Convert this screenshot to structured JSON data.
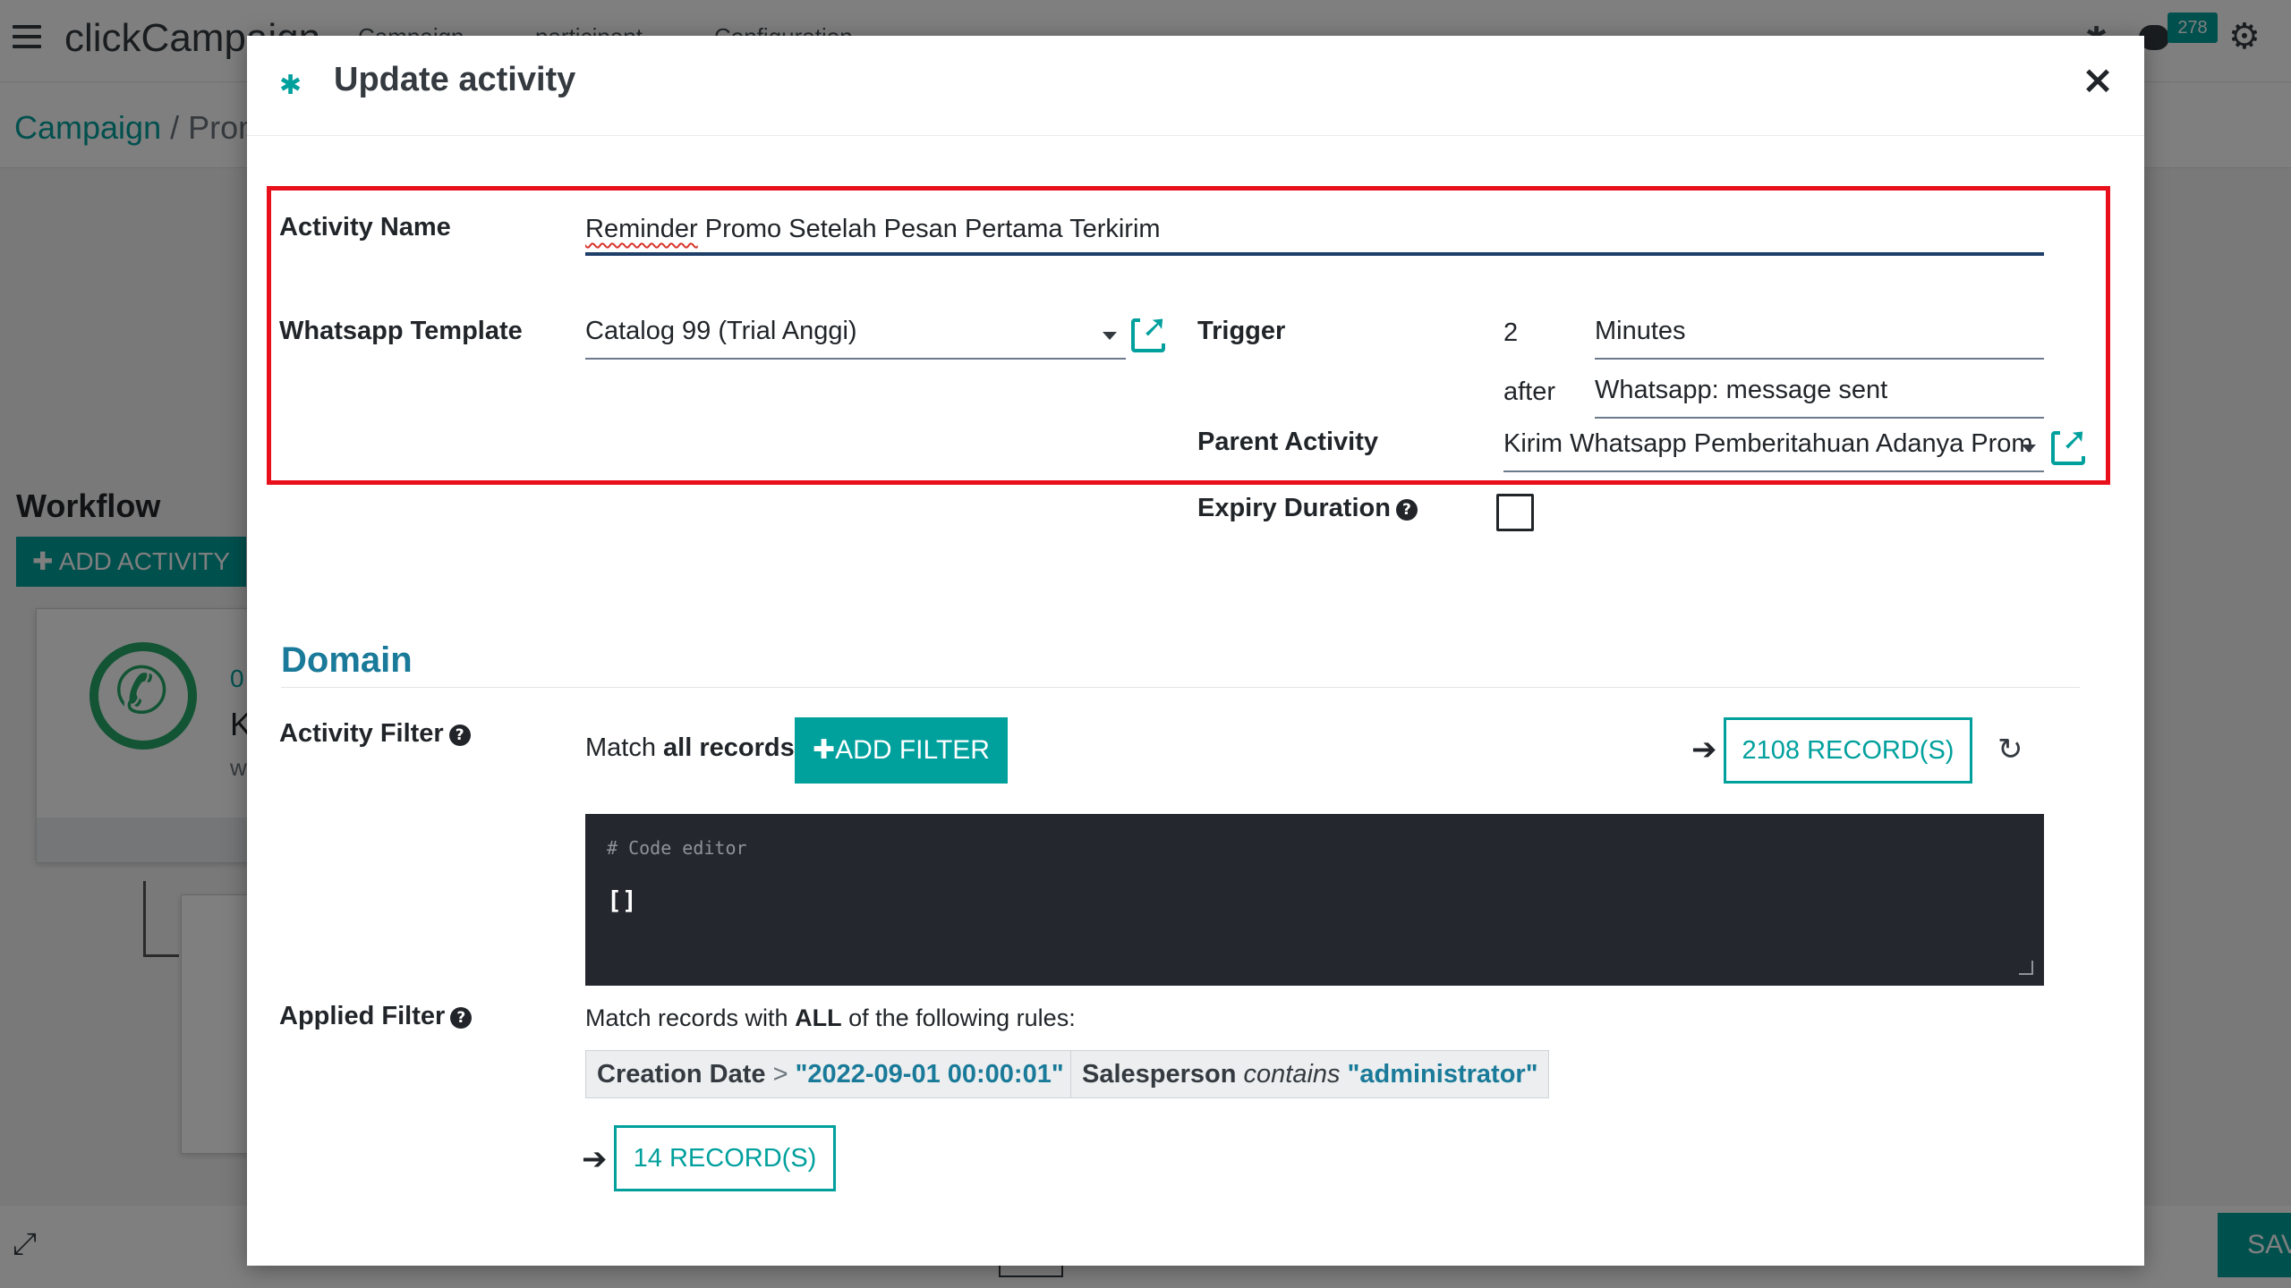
{
  "app": {
    "brand": "clickCampaign",
    "top_menu": [
      "Campaign",
      "participant",
      "Configuration"
    ],
    "notification_count": "278",
    "breadcrumb": {
      "root": "Campaign",
      "separator": " / ",
      "current": "Prom"
    },
    "workflow_title": "Workflow",
    "add_activity_label": "✚  ADD ACTIVITY",
    "card1_count": "0",
    "card1_initial": "K",
    "card1_sub": "w",
    "save_label": "SAV"
  },
  "modal": {
    "title": "Update activity",
    "close_glyph": "×",
    "activity_name_label": "Activity Name",
    "activity_name_misspelled": "Reminder",
    "activity_name_rest": " Promo Setelah Pesan Pertama Terkirim",
    "template_label": "Whatsapp Template",
    "template_value": "Catalog 99 (Trial Anggi)",
    "trigger_label": "Trigger",
    "trigger_number": "2",
    "trigger_unit": "Minutes",
    "trigger_after": "after",
    "trigger_event": "Whatsapp: message sent",
    "parent_label": "Parent Activity",
    "parent_value": "Kirim Whatsapp Pemberitahuan Adanya Prom",
    "expiry_label": "Expiry Duration",
    "expiry_checked": false,
    "domain_title": "Domain",
    "activity_filter_label": "Activity Filter",
    "match_prefix": "Match ",
    "match_bold": "all records",
    "add_filter_label": "✚ADD FILTER",
    "records_count_label": "2108 RECORD(S)",
    "code_comment": "# Code editor",
    "code_value": "[]",
    "applied_filter_label": "Applied Filter",
    "rules_prefix": "Match records with ",
    "rules_bold": "ALL",
    "rules_suffix": " of the following rules:",
    "rule1": {
      "field": "Creation Date",
      "operator": ">",
      "value": "\"2022-09-01 00:00:01\""
    },
    "rule2": {
      "field": "Salesperson",
      "operator": "contains",
      "value": "\"administrator\""
    },
    "applied_records_label": "14 RECORD(S)"
  },
  "colors": {
    "accent": "#00a09d",
    "highlight_border": "#e8101a",
    "domain_title": "#1a7a99",
    "code_bg": "#25272e"
  },
  "icons": [
    "menu-icon",
    "bug-icon",
    "close-icon",
    "external-link-icon",
    "help-icon",
    "arrow-right-icon",
    "refresh-icon",
    "whatsapp-icon",
    "gear-icon",
    "chat-icon",
    "expand-icon"
  ]
}
